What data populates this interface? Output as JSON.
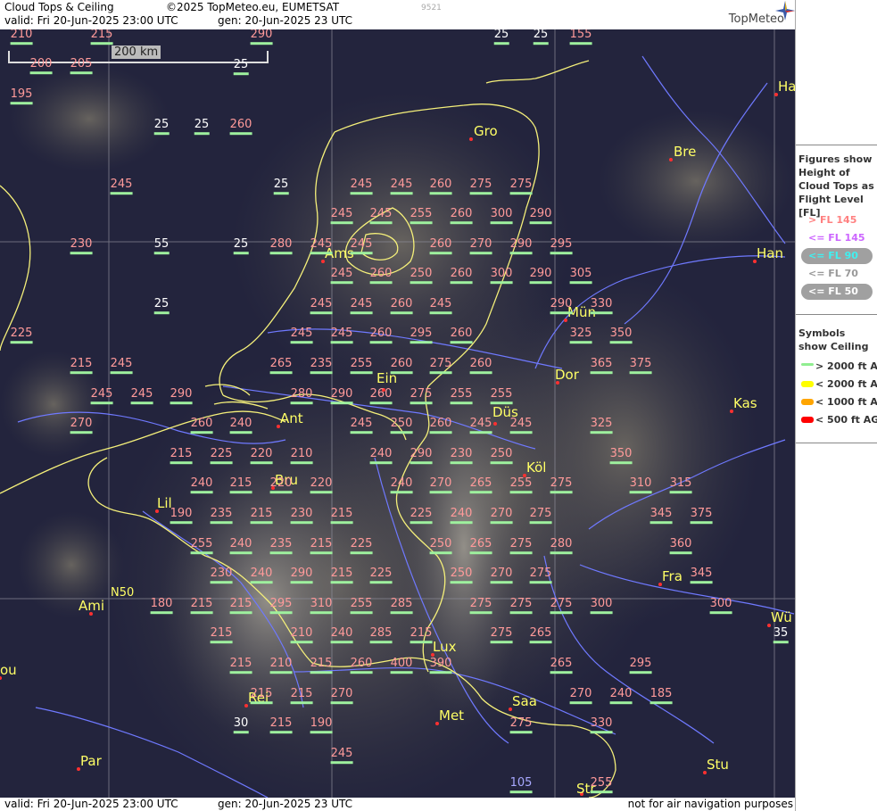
{
  "header": {
    "title": "Cloud Tops & Ceiling",
    "copyright": "©2025 TopMeteo.eu, EUMETSAT",
    "code": "9521",
    "valid": "valid:  Fri  20-Jun-2025  23:00 UTC",
    "gen": "gen: 20-Jun-2025 23 UTC",
    "brand": "TopMeteo"
  },
  "footer": {
    "valid": "valid:  Fri  20-Jun-2025  23:00 UTC",
    "gen": "gen: 20-Jun-2025 23 UTC",
    "disclaimer": "not for air navigation purposes"
  },
  "map": {
    "scale_label": "200 km",
    "lat_label": "N50",
    "colors": {
      "background": "#23243d",
      "border": "#f5f07a",
      "river": "#6f79ff",
      "grid": "#8d8d99",
      "city": "#ffff66"
    },
    "cities": [
      {
        "name": "Gro"
      },
      {
        "name": "Bre"
      },
      {
        "name": "Ha"
      },
      {
        "name": "Han"
      },
      {
        "name": "Ams"
      },
      {
        "name": "Mün"
      },
      {
        "name": "Ein"
      },
      {
        "name": "Dor"
      },
      {
        "name": "Kas"
      },
      {
        "name": "Ant"
      },
      {
        "name": "Düs"
      },
      {
        "name": "Köl"
      },
      {
        "name": "Bru"
      },
      {
        "name": "Lil"
      },
      {
        "name": "Fra"
      },
      {
        "name": "Ami"
      },
      {
        "name": "Lux"
      },
      {
        "name": "Wü"
      },
      {
        "name": "ou"
      },
      {
        "name": "Saa"
      },
      {
        "name": "Rei"
      },
      {
        "name": "Met"
      },
      {
        "name": "Par"
      },
      {
        "name": "Stu"
      },
      {
        "name": "Str"
      }
    ],
    "flight_levels": [
      {
        "v": "210",
        "c": "pink"
      },
      {
        "v": "215",
        "c": "pink"
      },
      {
        "v": "290",
        "c": "pink"
      },
      {
        "v": "25",
        "c": "white"
      },
      {
        "v": "25",
        "c": "white"
      },
      {
        "v": "155",
        "c": "pink"
      },
      {
        "v": "200",
        "c": "pink"
      },
      {
        "v": "205",
        "c": "pink"
      },
      {
        "v": "25",
        "c": "white"
      },
      {
        "v": "195",
        "c": "pink"
      },
      {
        "v": "25",
        "c": "white"
      },
      {
        "v": "25",
        "c": "white"
      },
      {
        "v": "260",
        "c": "pink"
      },
      {
        "v": "245",
        "c": "pink"
      },
      {
        "v": "25",
        "c": "white"
      },
      {
        "v": "245",
        "c": "pink"
      },
      {
        "v": "245",
        "c": "pink"
      },
      {
        "v": "260",
        "c": "pink"
      },
      {
        "v": "275",
        "c": "pink"
      },
      {
        "v": "275",
        "c": "pink"
      },
      {
        "v": "245",
        "c": "pink"
      },
      {
        "v": "245",
        "c": "pink"
      },
      {
        "v": "255",
        "c": "pink"
      },
      {
        "v": "260",
        "c": "pink"
      },
      {
        "v": "300",
        "c": "pink"
      },
      {
        "v": "290",
        "c": "pink"
      },
      {
        "v": "230",
        "c": "pink"
      },
      {
        "v": "55",
        "c": "white"
      },
      {
        "v": "25",
        "c": "white"
      },
      {
        "v": "280",
        "c": "pink"
      },
      {
        "v": "245",
        "c": "pink"
      },
      {
        "v": "245",
        "c": "pink"
      },
      {
        "v": "260",
        "c": "pink"
      },
      {
        "v": "270",
        "c": "pink"
      },
      {
        "v": "290",
        "c": "pink"
      },
      {
        "v": "295",
        "c": "pink"
      },
      {
        "v": "245",
        "c": "pink"
      },
      {
        "v": "260",
        "c": "pink"
      },
      {
        "v": "250",
        "c": "pink"
      },
      {
        "v": "260",
        "c": "pink"
      },
      {
        "v": "300",
        "c": "pink"
      },
      {
        "v": "290",
        "c": "pink"
      },
      {
        "v": "305",
        "c": "pink"
      },
      {
        "v": "25",
        "c": "white"
      },
      {
        "v": "245",
        "c": "pink"
      },
      {
        "v": "245",
        "c": "pink"
      },
      {
        "v": "260",
        "c": "pink"
      },
      {
        "v": "245",
        "c": "pink"
      },
      {
        "v": "290",
        "c": "pink"
      },
      {
        "v": "330",
        "c": "pink"
      },
      {
        "v": "225",
        "c": "pink"
      },
      {
        "v": "245",
        "c": "pink"
      },
      {
        "v": "245",
        "c": "pink"
      },
      {
        "v": "260",
        "c": "pink"
      },
      {
        "v": "295",
        "c": "pink"
      },
      {
        "v": "260",
        "c": "pink"
      },
      {
        "v": "325",
        "c": "pink"
      },
      {
        "v": "350",
        "c": "pink"
      },
      {
        "v": "215",
        "c": "pink"
      },
      {
        "v": "245",
        "c": "pink"
      },
      {
        "v": "265",
        "c": "pink"
      },
      {
        "v": "235",
        "c": "pink"
      },
      {
        "v": "255",
        "c": "pink"
      },
      {
        "v": "260",
        "c": "pink"
      },
      {
        "v": "275",
        "c": "pink"
      },
      {
        "v": "260",
        "c": "pink"
      },
      {
        "v": "365",
        "c": "pink"
      },
      {
        "v": "375",
        "c": "pink"
      },
      {
        "v": "245",
        "c": "pink"
      },
      {
        "v": "245",
        "c": "pink"
      },
      {
        "v": "290",
        "c": "pink"
      },
      {
        "v": "280",
        "c": "pink"
      },
      {
        "v": "290",
        "c": "pink"
      },
      {
        "v": "260",
        "c": "pink"
      },
      {
        "v": "275",
        "c": "pink"
      },
      {
        "v": "255",
        "c": "pink"
      },
      {
        "v": "255",
        "c": "pink"
      },
      {
        "v": "270",
        "c": "pink"
      },
      {
        "v": "260",
        "c": "pink"
      },
      {
        "v": "240",
        "c": "pink"
      },
      {
        "v": "245",
        "c": "pink"
      },
      {
        "v": "250",
        "c": "pink"
      },
      {
        "v": "260",
        "c": "pink"
      },
      {
        "v": "245",
        "c": "pink"
      },
      {
        "v": "245",
        "c": "pink"
      },
      {
        "v": "325",
        "c": "pink"
      },
      {
        "v": "215",
        "c": "pink"
      },
      {
        "v": "225",
        "c": "pink"
      },
      {
        "v": "220",
        "c": "pink"
      },
      {
        "v": "210",
        "c": "pink"
      },
      {
        "v": "240",
        "c": "pink"
      },
      {
        "v": "290",
        "c": "pink"
      },
      {
        "v": "230",
        "c": "pink"
      },
      {
        "v": "250",
        "c": "pink"
      },
      {
        "v": "350",
        "c": "pink"
      },
      {
        "v": "240",
        "c": "pink"
      },
      {
        "v": "215",
        "c": "pink"
      },
      {
        "v": "220",
        "c": "pink"
      },
      {
        "v": "220",
        "c": "pink"
      },
      {
        "v": "240",
        "c": "pink"
      },
      {
        "v": "270",
        "c": "pink"
      },
      {
        "v": "265",
        "c": "pink"
      },
      {
        "v": "255",
        "c": "pink"
      },
      {
        "v": "275",
        "c": "pink"
      },
      {
        "v": "310",
        "c": "pink"
      },
      {
        "v": "315",
        "c": "pink"
      },
      {
        "v": "190",
        "c": "pink"
      },
      {
        "v": "235",
        "c": "pink"
      },
      {
        "v": "215",
        "c": "pink"
      },
      {
        "v": "230",
        "c": "pink"
      },
      {
        "v": "215",
        "c": "pink"
      },
      {
        "v": "225",
        "c": "pink"
      },
      {
        "v": "240",
        "c": "pink"
      },
      {
        "v": "270",
        "c": "pink"
      },
      {
        "v": "275",
        "c": "pink"
      },
      {
        "v": "345",
        "c": "pink"
      },
      {
        "v": "375",
        "c": "pink"
      },
      {
        "v": "255",
        "c": "pink"
      },
      {
        "v": "240",
        "c": "pink"
      },
      {
        "v": "235",
        "c": "pink"
      },
      {
        "v": "215",
        "c": "pink"
      },
      {
        "v": "225",
        "c": "pink"
      },
      {
        "v": "250",
        "c": "pink"
      },
      {
        "v": "265",
        "c": "pink"
      },
      {
        "v": "275",
        "c": "pink"
      },
      {
        "v": "280",
        "c": "pink"
      },
      {
        "v": "360",
        "c": "pink"
      },
      {
        "v": "230",
        "c": "pink"
      },
      {
        "v": "240",
        "c": "pink"
      },
      {
        "v": "290",
        "c": "pink"
      },
      {
        "v": "215",
        "c": "pink"
      },
      {
        "v": "225",
        "c": "pink"
      },
      {
        "v": "250",
        "c": "pink"
      },
      {
        "v": "270",
        "c": "pink"
      },
      {
        "v": "275",
        "c": "pink"
      },
      {
        "v": "345",
        "c": "pink"
      },
      {
        "v": "180",
        "c": "pink"
      },
      {
        "v": "215",
        "c": "pink"
      },
      {
        "v": "215",
        "c": "pink"
      },
      {
        "v": "295",
        "c": "pink"
      },
      {
        "v": "310",
        "c": "pink"
      },
      {
        "v": "255",
        "c": "pink"
      },
      {
        "v": "285",
        "c": "pink"
      },
      {
        "v": "275",
        "c": "pink"
      },
      {
        "v": "275",
        "c": "pink"
      },
      {
        "v": "275",
        "c": "pink"
      },
      {
        "v": "300",
        "c": "pink"
      },
      {
        "v": "300",
        "c": "pink"
      },
      {
        "v": "215",
        "c": "pink"
      },
      {
        "v": "210",
        "c": "pink"
      },
      {
        "v": "240",
        "c": "pink"
      },
      {
        "v": "285",
        "c": "pink"
      },
      {
        "v": "215",
        "c": "pink"
      },
      {
        "v": "275",
        "c": "pink"
      },
      {
        "v": "265",
        "c": "pink"
      },
      {
        "v": "35",
        "c": "white"
      },
      {
        "v": "215",
        "c": "pink"
      },
      {
        "v": "210",
        "c": "pink"
      },
      {
        "v": "215",
        "c": "pink"
      },
      {
        "v": "260",
        "c": "pink"
      },
      {
        "v": "400",
        "c": "pink"
      },
      {
        "v": "390",
        "c": "pink"
      },
      {
        "v": "265",
        "c": "pink"
      },
      {
        "v": "295",
        "c": "pink"
      },
      {
        "v": "215",
        "c": "pink"
      },
      {
        "v": "215",
        "c": "pink"
      },
      {
        "v": "270",
        "c": "pink"
      },
      {
        "v": "270",
        "c": "pink"
      },
      {
        "v": "240",
        "c": "pink"
      },
      {
        "v": "185",
        "c": "pink"
      },
      {
        "v": "30",
        "c": "white"
      },
      {
        "v": "215",
        "c": "pink"
      },
      {
        "v": "190",
        "c": "pink"
      },
      {
        "v": "275",
        "c": "pink"
      },
      {
        "v": "330",
        "c": "pink"
      },
      {
        "v": "245",
        "c": "pink"
      },
      {
        "v": "105",
        "c": "blue"
      },
      {
        "v": "255",
        "c": "pink"
      }
    ]
  },
  "legend": {
    "tops_title": "Figures show Height of Cloud Tops as Flight Level  [FL]",
    "tops_items": [
      {
        "label": "> FL 145",
        "color": "#ff8080"
      },
      {
        "label": "<= FL 145",
        "color": "#cc66ff"
      },
      {
        "label": "<= FL 90",
        "color": "#40f0f0"
      },
      {
        "label": "<= FL 70",
        "color": "#999999"
      },
      {
        "label": "<= FL 50",
        "color": "#ffffff"
      }
    ],
    "ceiling_title": "Symbols show Ceiling",
    "ceiling_items": [
      {
        "label": "> 2000 ft AGL",
        "color": "#90ee90"
      },
      {
        "label": "< 2000 ft AGL",
        "color": "#ffff00"
      },
      {
        "label": "< 1000 ft AGL",
        "color": "#ffa500"
      },
      {
        "label": "< 500 ft AGL",
        "color": "#ff0000"
      }
    ]
  }
}
